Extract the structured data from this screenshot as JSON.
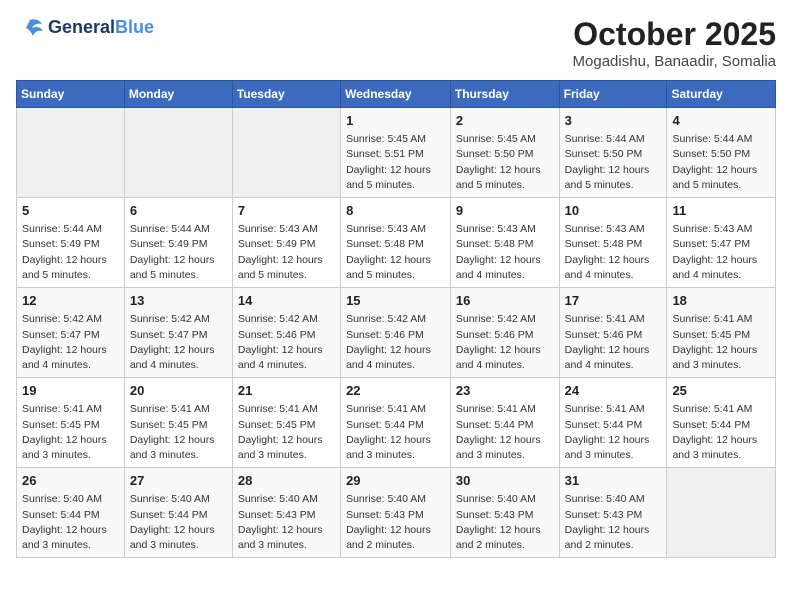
{
  "logo": {
    "line1": "General",
    "line2": "Blue"
  },
  "title": "October 2025",
  "subtitle": "Mogadishu, Banaadir, Somalia",
  "weekdays": [
    "Sunday",
    "Monday",
    "Tuesday",
    "Wednesday",
    "Thursday",
    "Friday",
    "Saturday"
  ],
  "weeks": [
    [
      {
        "day": "",
        "info": ""
      },
      {
        "day": "",
        "info": ""
      },
      {
        "day": "",
        "info": ""
      },
      {
        "day": "1",
        "info": "Sunrise: 5:45 AM\nSunset: 5:51 PM\nDaylight: 12 hours\nand 5 minutes."
      },
      {
        "day": "2",
        "info": "Sunrise: 5:45 AM\nSunset: 5:50 PM\nDaylight: 12 hours\nand 5 minutes."
      },
      {
        "day": "3",
        "info": "Sunrise: 5:44 AM\nSunset: 5:50 PM\nDaylight: 12 hours\nand 5 minutes."
      },
      {
        "day": "4",
        "info": "Sunrise: 5:44 AM\nSunset: 5:50 PM\nDaylight: 12 hours\nand 5 minutes."
      }
    ],
    [
      {
        "day": "5",
        "info": "Sunrise: 5:44 AM\nSunset: 5:49 PM\nDaylight: 12 hours\nand 5 minutes."
      },
      {
        "day": "6",
        "info": "Sunrise: 5:44 AM\nSunset: 5:49 PM\nDaylight: 12 hours\nand 5 minutes."
      },
      {
        "day": "7",
        "info": "Sunrise: 5:43 AM\nSunset: 5:49 PM\nDaylight: 12 hours\nand 5 minutes."
      },
      {
        "day": "8",
        "info": "Sunrise: 5:43 AM\nSunset: 5:48 PM\nDaylight: 12 hours\nand 5 minutes."
      },
      {
        "day": "9",
        "info": "Sunrise: 5:43 AM\nSunset: 5:48 PM\nDaylight: 12 hours\nand 4 minutes."
      },
      {
        "day": "10",
        "info": "Sunrise: 5:43 AM\nSunset: 5:48 PM\nDaylight: 12 hours\nand 4 minutes."
      },
      {
        "day": "11",
        "info": "Sunrise: 5:43 AM\nSunset: 5:47 PM\nDaylight: 12 hours\nand 4 minutes."
      }
    ],
    [
      {
        "day": "12",
        "info": "Sunrise: 5:42 AM\nSunset: 5:47 PM\nDaylight: 12 hours\nand 4 minutes."
      },
      {
        "day": "13",
        "info": "Sunrise: 5:42 AM\nSunset: 5:47 PM\nDaylight: 12 hours\nand 4 minutes."
      },
      {
        "day": "14",
        "info": "Sunrise: 5:42 AM\nSunset: 5:46 PM\nDaylight: 12 hours\nand 4 minutes."
      },
      {
        "day": "15",
        "info": "Sunrise: 5:42 AM\nSunset: 5:46 PM\nDaylight: 12 hours\nand 4 minutes."
      },
      {
        "day": "16",
        "info": "Sunrise: 5:42 AM\nSunset: 5:46 PM\nDaylight: 12 hours\nand 4 minutes."
      },
      {
        "day": "17",
        "info": "Sunrise: 5:41 AM\nSunset: 5:46 PM\nDaylight: 12 hours\nand 4 minutes."
      },
      {
        "day": "18",
        "info": "Sunrise: 5:41 AM\nSunset: 5:45 PM\nDaylight: 12 hours\nand 3 minutes."
      }
    ],
    [
      {
        "day": "19",
        "info": "Sunrise: 5:41 AM\nSunset: 5:45 PM\nDaylight: 12 hours\nand 3 minutes."
      },
      {
        "day": "20",
        "info": "Sunrise: 5:41 AM\nSunset: 5:45 PM\nDaylight: 12 hours\nand 3 minutes."
      },
      {
        "day": "21",
        "info": "Sunrise: 5:41 AM\nSunset: 5:45 PM\nDaylight: 12 hours\nand 3 minutes."
      },
      {
        "day": "22",
        "info": "Sunrise: 5:41 AM\nSunset: 5:44 PM\nDaylight: 12 hours\nand 3 minutes."
      },
      {
        "day": "23",
        "info": "Sunrise: 5:41 AM\nSunset: 5:44 PM\nDaylight: 12 hours\nand 3 minutes."
      },
      {
        "day": "24",
        "info": "Sunrise: 5:41 AM\nSunset: 5:44 PM\nDaylight: 12 hours\nand 3 minutes."
      },
      {
        "day": "25",
        "info": "Sunrise: 5:41 AM\nSunset: 5:44 PM\nDaylight: 12 hours\nand 3 minutes."
      }
    ],
    [
      {
        "day": "26",
        "info": "Sunrise: 5:40 AM\nSunset: 5:44 PM\nDaylight: 12 hours\nand 3 minutes."
      },
      {
        "day": "27",
        "info": "Sunrise: 5:40 AM\nSunset: 5:44 PM\nDaylight: 12 hours\nand 3 minutes."
      },
      {
        "day": "28",
        "info": "Sunrise: 5:40 AM\nSunset: 5:43 PM\nDaylight: 12 hours\nand 3 minutes."
      },
      {
        "day": "29",
        "info": "Sunrise: 5:40 AM\nSunset: 5:43 PM\nDaylight: 12 hours\nand 2 minutes."
      },
      {
        "day": "30",
        "info": "Sunrise: 5:40 AM\nSunset: 5:43 PM\nDaylight: 12 hours\nand 2 minutes."
      },
      {
        "day": "31",
        "info": "Sunrise: 5:40 AM\nSunset: 5:43 PM\nDaylight: 12 hours\nand 2 minutes."
      },
      {
        "day": "",
        "info": ""
      }
    ]
  ]
}
